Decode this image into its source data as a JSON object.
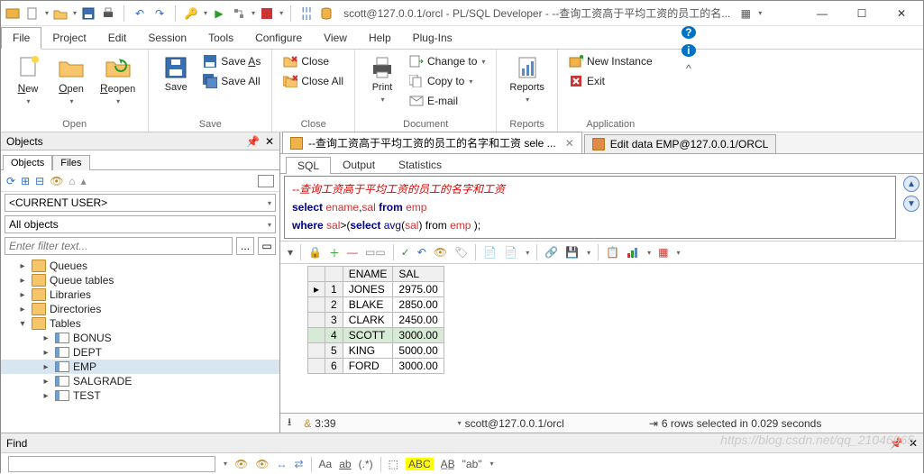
{
  "title_connection": "scott@127.0.0.1/orcl - PL/SQL Developer - --查询工资高于平均工资的员工的名...",
  "menus": [
    "File",
    "Project",
    "Edit",
    "Session",
    "Tools",
    "Configure",
    "View",
    "Help",
    "Plug-Ins"
  ],
  "active_menu": "File",
  "ribbon": {
    "open": {
      "new": "New",
      "open": "Open",
      "reopen": "Reopen",
      "label": "Open"
    },
    "save": {
      "save": "Save",
      "saveas": "Save As",
      "saveall": "Save All",
      "label": "Save"
    },
    "close": {
      "close": "Close",
      "closeall": "Close All",
      "label": "Close"
    },
    "doc": {
      "print": "Print",
      "changeto": "Change to",
      "copyto": "Copy to",
      "email": "E-mail",
      "label": "Document"
    },
    "reports": {
      "reports": "Reports",
      "label": "Reports"
    },
    "app": {
      "newinst": "New Instance",
      "exit": "Exit",
      "label": "Application"
    }
  },
  "objects_panel": {
    "title": "Objects",
    "tabs": [
      "Objects",
      "Files"
    ],
    "current_user": "<CURRENT USER>",
    "all_objects": "All objects",
    "filter_placeholder": "Enter filter text...",
    "tree_top": [
      "Queues",
      "Queue tables",
      "Libraries",
      "Directories"
    ],
    "tables_label": "Tables",
    "tables": [
      "BONUS",
      "DEPT",
      "EMP",
      "SALGRADE",
      "TEST"
    ],
    "selected_table": "EMP"
  },
  "doc_tabs": [
    {
      "label": "--查询工资高于平均工资的员工的名字和工资 sele ...",
      "active": true,
      "closable": true
    },
    {
      "label": "Edit data EMP@127.0.0.1/ORCL",
      "active": false,
      "closable": false
    }
  ],
  "inner_tabs": [
    "SQL",
    "Output",
    "Statistics"
  ],
  "sql_lines": {
    "comment": "--查询工资高于平均工资的员工的名字和工资",
    "l2a": "select",
    "l2b": "ename",
    "l2c": ",",
    "l2d": "sal",
    "l2e": " from ",
    "l2f": "emp",
    "l3a": "where ",
    "l3b": "sal",
    "l3c": ">(",
    "l3d": "select ",
    "l3e": "avg",
    "l3f": "(",
    "l3g": "sal",
    "l3h": ") from ",
    "l3i": "emp",
    "l3j": " );"
  },
  "grid": {
    "cols": [
      "ENAME",
      "SAL"
    ],
    "rows": [
      {
        "n": 1,
        "ENAME": "JONES",
        "SAL": "2975.00"
      },
      {
        "n": 2,
        "ENAME": "BLAKE",
        "SAL": "2850.00"
      },
      {
        "n": 3,
        "ENAME": "CLARK",
        "SAL": "2450.00"
      },
      {
        "n": 4,
        "ENAME": "SCOTT",
        "SAL": "3000.00"
      },
      {
        "n": 5,
        "ENAME": "KING",
        "SAL": "5000.00"
      },
      {
        "n": 6,
        "ENAME": "FORD",
        "SAL": "3000.00"
      }
    ],
    "selected_row": 4
  },
  "status": {
    "cursor": "3:39",
    "conn": "scott@127.0.0.1/orcl",
    "rows": "6 rows selected in 0.029 seconds"
  },
  "find_label": "Find",
  "watermark": "https://blog.csdn.net/qq_21046965"
}
